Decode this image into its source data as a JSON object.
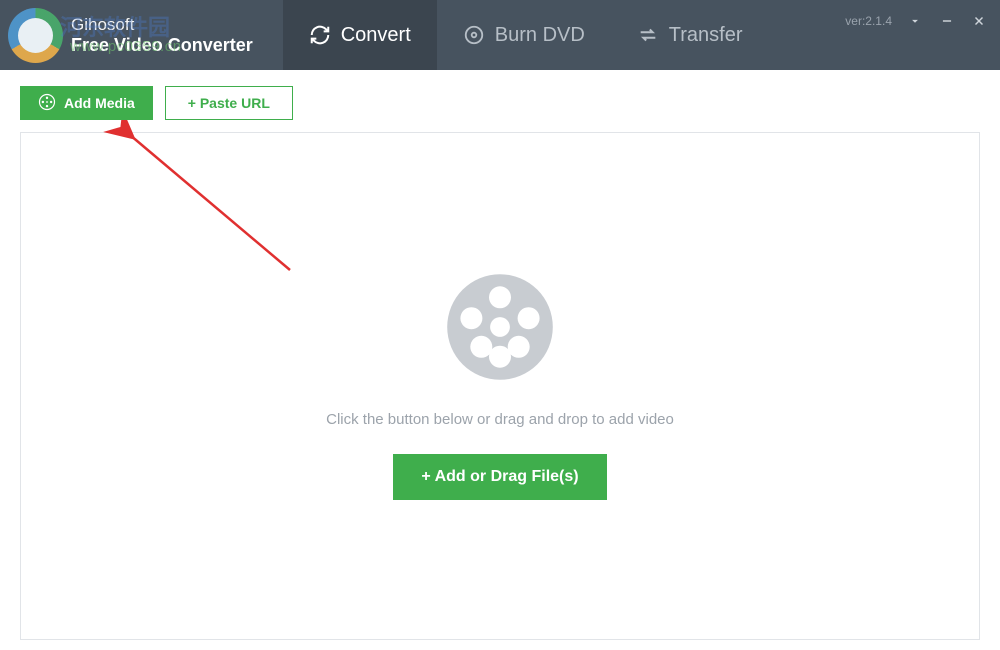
{
  "brand": {
    "line1": "Gihosoft",
    "line2": "Free Video Converter"
  },
  "watermark_en": "www.pc0359.cn",
  "watermark_cn": "河东软件园",
  "tabs": {
    "convert": "Convert",
    "burn": "Burn DVD",
    "transfer": "Transfer"
  },
  "version": "ver:2.1.4",
  "toolbar": {
    "add_media": "Add Media",
    "paste_url": "+ Paste URL"
  },
  "empty_state": {
    "hint": "Click the button below or drag and drop to add video",
    "add_button": "+ Add or Drag File(s)"
  }
}
